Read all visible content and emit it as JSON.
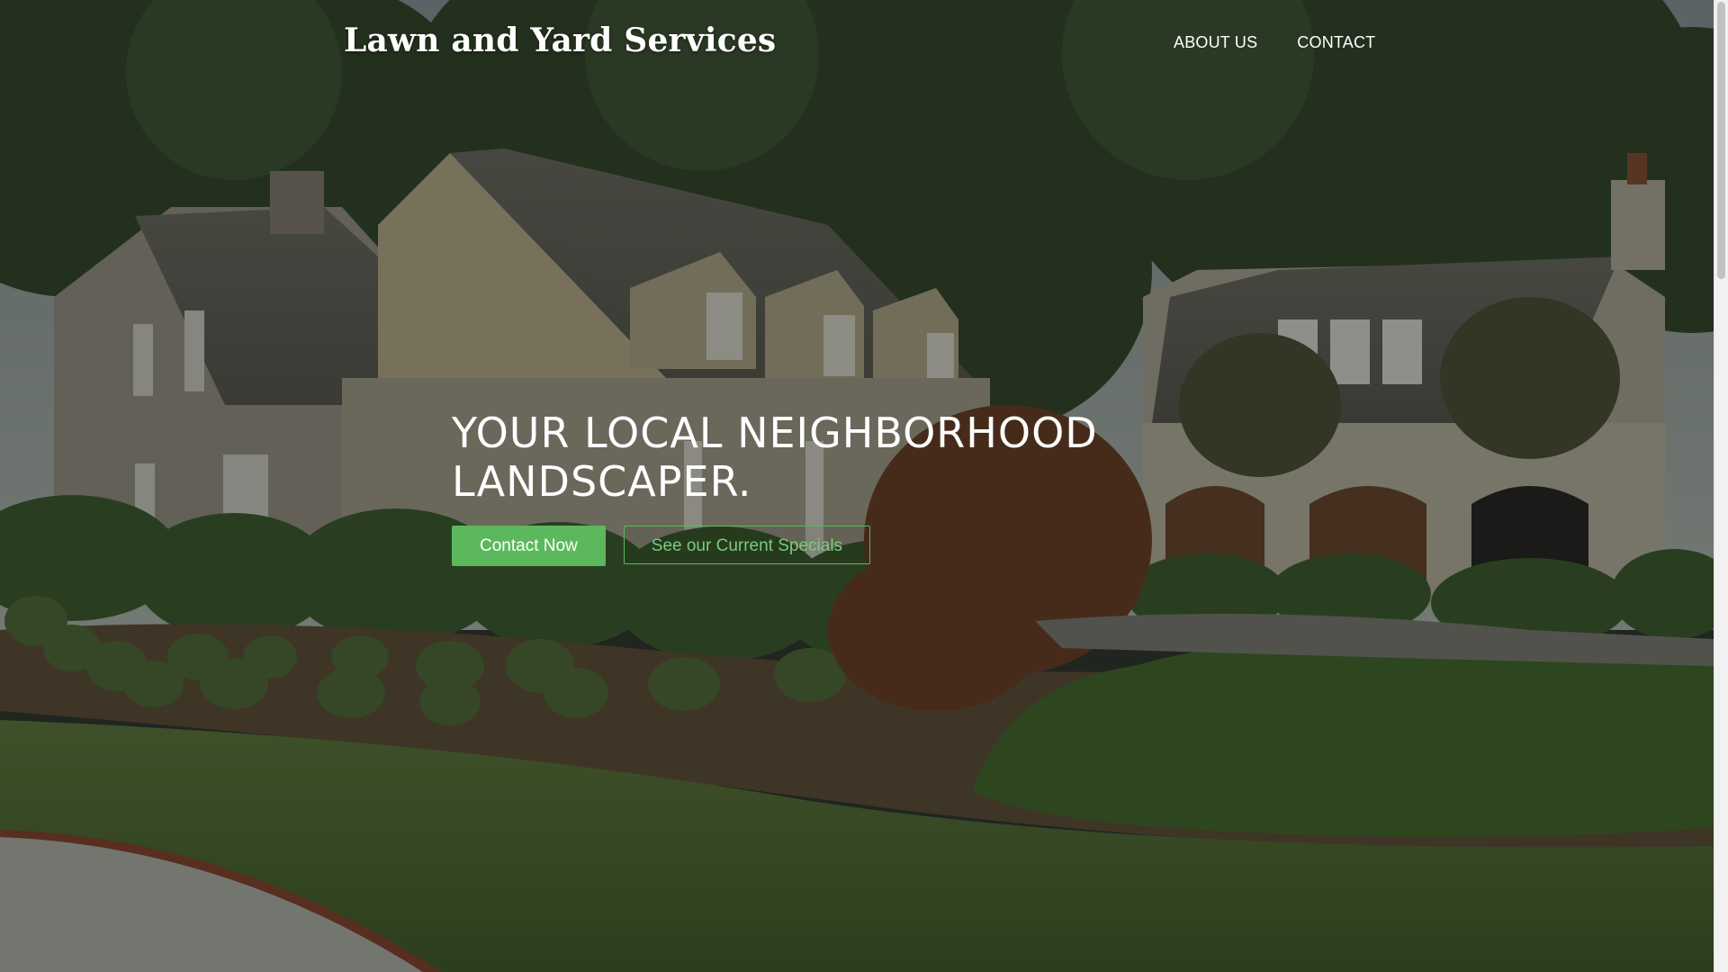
{
  "header": {
    "site_title": "Lawn and Yard Services",
    "nav": [
      {
        "label": "ABOUT US"
      },
      {
        "label": "CONTACT"
      }
    ]
  },
  "hero": {
    "headline": "YOUR LOCAL NEIGHBORHOOD LANDSCAPER.",
    "primary_button": "Contact Now",
    "secondary_button": "See our Current Specials"
  },
  "colors": {
    "accent_green": "#5cb85c",
    "text_white": "#ffffff"
  }
}
